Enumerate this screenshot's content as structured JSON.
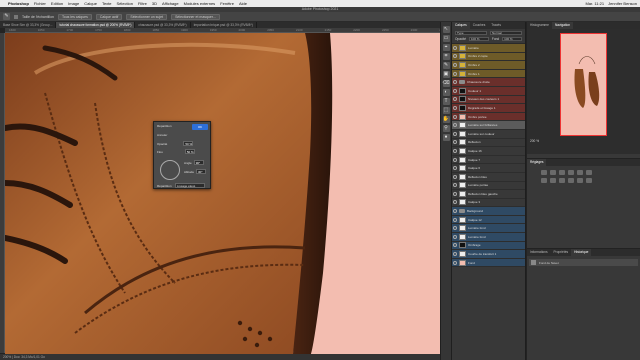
{
  "menubar": {
    "app_name": "Photoshop",
    "items": [
      "Fichier",
      "Edition",
      "Image",
      "Calque",
      "Texte",
      "Sélection",
      "Filtre",
      "3D",
      "Affichage",
      "Modules externes",
      "Fenêtre",
      "Aide"
    ],
    "clock": "Mar. 11:21",
    "user": "Jennifer Benson"
  },
  "window": {
    "title": "Adobe Photoshop 2021"
  },
  "options_bar": {
    "sample_label": "Taille de l'échantillon",
    "btn1": "Tous les calques",
    "btn2": "Calque actif",
    "btn3": "Sélectionner un sujet",
    "btn4": "Sélectionner et masquer..."
  },
  "doc_tabs": [
    {
      "label": "Base Shoe Sim @ 33,3% (Group...",
      "active": false
    },
    {
      "label": "tutorial chaussure formation.psd @ 200% (RVB/8*)",
      "active": true
    },
    {
      "label": "chaussure.psd @ 33,3% (RVB/8*)",
      "active": false
    },
    {
      "label": "Importation brique.psd @ 33,3% (RVB/8*)",
      "active": false
    }
  ],
  "ruler_ticks": [
    "1600",
    "1650",
    "1700",
    "1750",
    "1800",
    "1850",
    "1900",
    "1950",
    "2000",
    "2050",
    "2100",
    "2150",
    "2200",
    "2250",
    "2300",
    "2350"
  ],
  "status_bar": {
    "text": "200% | Doc: 34,3 Mo/1,01 Go"
  },
  "toolbar": {
    "tools": [
      "↖",
      "▭",
      "⌖",
      "⌗",
      "✎",
      "▣",
      "⌫",
      "◐",
      "T",
      "⬚",
      "✋",
      "⚲",
      "●"
    ]
  },
  "layers_panel": {
    "tabs": [
      "Calques",
      "Couches",
      "Tracés"
    ],
    "active_tab": "Calques",
    "filter_label": "Type",
    "blend_mode": "Normal",
    "opacity_label": "Opacité",
    "opacity": "100 %",
    "fill_label": "Fond",
    "fill": "100 %",
    "lock_label": "Verrou :",
    "layers": [
      {
        "name": "Lumière",
        "style": "grp-y",
        "thumb": "yellow"
      },
      {
        "name": "Ombre 2 copie",
        "style": "grp-y",
        "thumb": "yellow"
      },
      {
        "name": "Ombre 2",
        "style": "grp-y",
        "thumb": "yellow"
      },
      {
        "name": "Ombre 1",
        "style": "grp-y",
        "thumb": "yellow"
      },
      {
        "name": "Chaussure droite",
        "style": "grp-r",
        "thumb": "folder"
      },
      {
        "name": "Couleur 1",
        "style": "grp-r",
        "thumb": "dark"
      },
      {
        "name": "Niveaux des couleurs 1",
        "style": "grp-r",
        "thumb": "dark"
      },
      {
        "name": "Dégradé et lissage 1",
        "style": "grp-r",
        "thumb": "dark"
      },
      {
        "name": "Ombre portée",
        "style": "grp-r",
        "thumb": "pink"
      },
      {
        "name": "Lumière sur brillances",
        "style": "sel",
        "thumb": ""
      },
      {
        "name": "Lumière sur couleur",
        "style": "",
        "thumb": ""
      },
      {
        "name": "Réflexion",
        "style": "",
        "thumb": ""
      },
      {
        "name": "Calque 16",
        "style": "",
        "thumb": ""
      },
      {
        "name": "Calque 7",
        "style": "",
        "thumb": ""
      },
      {
        "name": "Calque 6",
        "style": "",
        "thumb": ""
      },
      {
        "name": "Réflexion bleu",
        "style": "",
        "thumb": ""
      },
      {
        "name": "Lumière portée",
        "style": "",
        "thumb": ""
      },
      {
        "name": "Réflexion bleu gauche",
        "style": "",
        "thumb": ""
      },
      {
        "name": "Calque 3",
        "style": "",
        "thumb": ""
      },
      {
        "name": "Background",
        "style": "grp-b",
        "thumb": "folder"
      },
      {
        "name": "Calque 12",
        "style": "grp-b",
        "thumb": ""
      },
      {
        "name": "Lumière fond",
        "style": "grp-b",
        "thumb": ""
      },
      {
        "name": "Lumière fond",
        "style": "grp-b",
        "thumb": ""
      },
      {
        "name": "Ombrage",
        "style": "grp-b",
        "thumb": "dark"
      },
      {
        "name": "Courbe de transfert 1",
        "style": "grp-b",
        "thumb": ""
      },
      {
        "name": "Fond",
        "style": "grp-b",
        "thumb": "pink"
      }
    ]
  },
  "right_panel": {
    "nav_tabs": [
      "Histogramme",
      "Navigation"
    ],
    "zoom": "200 %",
    "mini_title": "Réglages",
    "bottom_tabs": [
      "Informations",
      "Propriétés",
      "Historique"
    ],
    "history_item": "Fond de Navet"
  },
  "dialog": {
    "title": "Répartition",
    "ok_label": "OK",
    "cancel_label": "Annuler",
    "field1_label": "Opacité",
    "field1_value": "50 %",
    "field2_label": "Flou",
    "field2_value": "50 %",
    "angle_label": "Angle",
    "angle_value": "90°",
    "altitude_label": "Altitude",
    "altitude_value": "30°",
    "mode_label": "Répartition",
    "mode_value": "Lissage élevé"
  },
  "colors": {
    "canvas_bg": "#f3bdb0",
    "leather": "#a8612e",
    "ring": "#e8e02a",
    "ok_button": "#2d6fd8"
  }
}
